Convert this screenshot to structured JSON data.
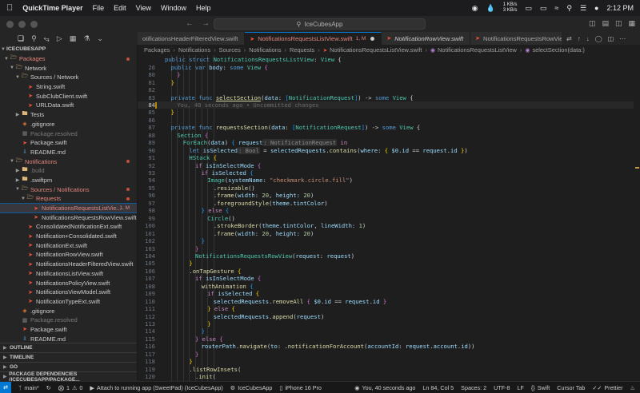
{
  "menubar": {
    "apple": "",
    "app_name": "QuickTime Player",
    "items": [
      "File",
      "Edit",
      "View",
      "Window",
      "Help"
    ],
    "net_up": "1 KB/s",
    "net_down": "3 KB/s",
    "clock": "2:12 PM"
  },
  "titlebar": {
    "search_text": "IceCubesApp"
  },
  "explorer": {
    "root": "ICECUBESAPP",
    "rows": [
      {
        "label": "Packages",
        "depth": 0,
        "type": "folder-open",
        "color": "red",
        "dot": true
      },
      {
        "label": "Network",
        "depth": 1,
        "type": "folder-open",
        "color": "white"
      },
      {
        "label": "Sources / Network",
        "depth": 2,
        "type": "folder-open",
        "color": "white"
      },
      {
        "label": "String.swift",
        "depth": 3,
        "type": "swift",
        "color": "white"
      },
      {
        "label": "SubClubClient.swift",
        "depth": 3,
        "type": "swift",
        "color": "white"
      },
      {
        "label": "URLData.swift",
        "depth": 3,
        "type": "swift",
        "color": "white"
      },
      {
        "label": "Tests",
        "depth": 2,
        "type": "folder",
        "color": "white"
      },
      {
        "label": ".gitignore",
        "depth": 2,
        "type": "git",
        "color": "white"
      },
      {
        "label": "Package.resolved",
        "depth": 2,
        "type": "file",
        "color": "gray"
      },
      {
        "label": "Package.swift",
        "depth": 2,
        "type": "swift",
        "color": "white"
      },
      {
        "label": "README.md",
        "depth": 2,
        "type": "md",
        "color": "white"
      },
      {
        "label": "Notifications",
        "depth": 1,
        "type": "folder-open",
        "color": "red",
        "dot": true
      },
      {
        "label": ".build",
        "depth": 2,
        "type": "folder",
        "color": "gray"
      },
      {
        "label": ".swiftpm",
        "depth": 2,
        "type": "folder",
        "color": "white"
      },
      {
        "label": "Sources / Notifications",
        "depth": 2,
        "type": "folder-open",
        "color": "red",
        "dot": true
      },
      {
        "label": "Requests",
        "depth": 3,
        "type": "folder-open",
        "color": "red",
        "dot": true
      },
      {
        "label": "NotificationsRequestsListVie...",
        "depth": 4,
        "type": "swift",
        "color": "red",
        "badge": "1, M",
        "selected": true
      },
      {
        "label": "NotificationsRequestsRowView.swift",
        "depth": 4,
        "type": "swift",
        "color": "white"
      },
      {
        "label": "ConsolidatedNotificationExt.swift",
        "depth": 3,
        "type": "swift",
        "color": "white"
      },
      {
        "label": "Notification+Consolidated.swift",
        "depth": 3,
        "type": "swift",
        "color": "white"
      },
      {
        "label": "NotificationExt.swift",
        "depth": 3,
        "type": "swift",
        "color": "white"
      },
      {
        "label": "NotificationRowView.swift",
        "depth": 3,
        "type": "swift",
        "color": "white"
      },
      {
        "label": "NotificationsHeaderFilteredView.swift",
        "depth": 3,
        "type": "swift",
        "color": "white"
      },
      {
        "label": "NotificationsListView.swift",
        "depth": 3,
        "type": "swift",
        "color": "white"
      },
      {
        "label": "NotificationsPolicyView.swift",
        "depth": 3,
        "type": "swift",
        "color": "white"
      },
      {
        "label": "NotificationsViewModel.swift",
        "depth": 3,
        "type": "swift",
        "color": "white"
      },
      {
        "label": "NotificationTypeExt.swift",
        "depth": 3,
        "type": "swift",
        "color": "white"
      },
      {
        "label": ".gitignore",
        "depth": 2,
        "type": "git",
        "color": "white"
      },
      {
        "label": "Package.resolved",
        "depth": 2,
        "type": "file",
        "color": "gray"
      },
      {
        "label": "Package.swift",
        "depth": 2,
        "type": "swift",
        "color": "white"
      },
      {
        "label": "README.md",
        "depth": 2,
        "type": "md",
        "color": "white"
      }
    ],
    "sections": [
      "OUTLINE",
      "TIMELINE",
      "GO",
      "PACKAGE DEPENDENCIES (ICECUBESAPP/PACKAGE..."
    ]
  },
  "tabs": [
    {
      "label": "otificationsHeaderFilteredView.swift",
      "active": false,
      "italic": false
    },
    {
      "label": "NotificationsRequestsListView.swift",
      "badge": "1, M",
      "active": true,
      "italic": false
    },
    {
      "label": "NotificationRowView.swift",
      "active": false,
      "italic": true
    },
    {
      "label": "NotificationsRequestsRowView.swift",
      "active": false,
      "italic": false
    }
  ],
  "breadcrumb": [
    "Packages",
    "Notifications",
    "Sources",
    "Notifications",
    "Requests",
    "NotificationsRequestsListView.swift",
    "NotificationsRequestsListView",
    "selectSection(data:)"
  ],
  "code": [
    {
      "n": "",
      "html": "<span class=\"kw2\">public struct</span> <span class=\"ty\">NotificationsRequestsListView</span>: <span class=\"ty\">View</span> {",
      "indent": 0
    },
    {
      "n": "26",
      "html": "<span class=\"kw2\">public var</span> <span class=\"pa\">body</span>: <span class=\"kw2\">some</span> <span class=\"ty\">View</span> <span class=\"br2\">{</span>",
      "indent": 1
    },
    {
      "n": "80",
      "html": "<span class=\"br2\">}</span>",
      "indent": 2
    },
    {
      "n": "81",
      "html": "<span class=\"br1\">}</span>",
      "indent": 1
    },
    {
      "n": "82",
      "html": "",
      "indent": 0
    },
    {
      "n": "83",
      "html": "<span class=\"kw2\">private func</span> <span class=\"fn\" style=\"text-decoration:underline\">selectSection</span>(<span class=\"pa\">data</span>: <span class=\"br3\">[</span><span class=\"ty\">NotificationRequest</span><span class=\"br3\">]</span>) -&gt; <span class=\"kw2\">some</span> <span class=\"ty\">View</span> {",
      "indent": 1
    },
    {
      "n": "84",
      "html": "<span class=\"cm\">You, 40 seconds ago • Uncommitted changes</span>",
      "indent": 2,
      "current": true,
      "mark": true
    },
    {
      "n": "85",
      "html": "<span class=\"br1\">}</span>",
      "indent": 1
    },
    {
      "n": "86",
      "html": "",
      "indent": 0
    },
    {
      "n": "87",
      "html": "<span class=\"kw2\">private func</span> <span class=\"fn\">requestsSection</span>(<span class=\"pa\">data</span>: <span class=\"br3\">[</span><span class=\"ty\">NotificationRequest</span><span class=\"br3\">]</span>) -&gt; <span class=\"kw2\">some</span> <span class=\"ty\">View</span> {",
      "indent": 1
    },
    {
      "n": "88",
      "html": "<span class=\"ty\">Section</span> <span class=\"br2\">{</span>",
      "indent": 2
    },
    {
      "n": "89",
      "html": "<span class=\"ty\">ForEach</span>(<span class=\"pa\">data</span>) <span class=\"br3\">{</span> <span class=\"pa\">request</span><span class=\"hint\">: NotificationRequest</span> <span class=\"kw\">in</span>",
      "indent": 3
    },
    {
      "n": "90",
      "html": "<span class=\"kw2\">let</span> <span class=\"pa\">isSelected</span><span class=\"hint\">: Bool</span> = <span class=\"pa\">selectedRequests</span>.<span class=\"fn\">contains</span>(<span class=\"pa\">where</span>: <span class=\"br1\">{</span> <span class=\"pa\">$0</span>.<span class=\"pa\">id</span> == <span class=\"pa\">request</span>.<span class=\"pa\">id</span> <span class=\"br1\">}</span>)",
      "indent": 4
    },
    {
      "n": "91",
      "html": "<span class=\"ty\">HStack</span> <span class=\"br1\">{</span>",
      "indent": 4
    },
    {
      "n": "92",
      "html": "<span class=\"kw\">if</span> <span class=\"pa\">isInSelectMode</span> <span class=\"br2\">{</span>",
      "indent": 5
    },
    {
      "n": "93",
      "html": "<span class=\"kw\">if</span> <span class=\"pa\">isSelected</span> <span class=\"br3\">{</span>",
      "indent": 6
    },
    {
      "n": "94",
      "html": "<span class=\"ty\">Image</span>(<span class=\"pa\">systemName</span>: <span class=\"st\">\"checkmark.circle.fill\"</span>)",
      "indent": 7
    },
    {
      "n": "95",
      "html": ".<span class=\"fn\">resizable</span>()",
      "indent": 8
    },
    {
      "n": "96",
      "html": ".<span class=\"fn\">frame</span>(<span class=\"pa\">width</span>: <span class=\"nu\">20</span>, <span class=\"pa\">height</span>: <span class=\"nu\">20</span>)",
      "indent": 8
    },
    {
      "n": "97",
      "html": ".<span class=\"fn\">foregroundStyle</span>(<span class=\"pa\">theme</span>.<span class=\"pa\">tintColor</span>)",
      "indent": 8
    },
    {
      "n": "98",
      "html": "<span class=\"br3\">}</span> <span class=\"kw\">else</span> <span class=\"br3\">{</span>",
      "indent": 6
    },
    {
      "n": "99",
      "html": "<span class=\"ty\">Circle</span>()",
      "indent": 7
    },
    {
      "n": "100",
      "html": ".<span class=\"fn\">strokeBorder</span>(<span class=\"pa\">theme</span>.<span class=\"pa\">tintColor</span>, <span class=\"pa\">lineWidth</span>: <span class=\"nu\">1</span>)",
      "indent": 8
    },
    {
      "n": "101",
      "html": ".<span class=\"fn\">frame</span>(<span class=\"pa\">width</span>: <span class=\"nu\">20</span>, <span class=\"pa\">height</span>: <span class=\"nu\">20</span>)",
      "indent": 8
    },
    {
      "n": "102",
      "html": "<span class=\"br3\">}</span>",
      "indent": 6
    },
    {
      "n": "103",
      "html": "<span class=\"br2\">}</span>",
      "indent": 5
    },
    {
      "n": "104",
      "html": "<span class=\"ty\">NotificationsRequestsRowView</span>(<span class=\"pa\">request</span>: <span class=\"pa\">request</span>)",
      "indent": 5
    },
    {
      "n": "105",
      "html": "<span class=\"br1\">}</span>",
      "indent": 4
    },
    {
      "n": "106",
      "html": ".<span class=\"fn\">onTapGesture</span> <span class=\"br1\">{</span>",
      "indent": 4
    },
    {
      "n": "107",
      "html": "<span class=\"kw\">if</span> <span class=\"pa\">isInSelectMode</span> <span class=\"br2\">{</span>",
      "indent": 5
    },
    {
      "n": "108",
      "html": "<span class=\"fn\">withAnimation</span> <span class=\"br3\">{</span>",
      "indent": 6
    },
    {
      "n": "109",
      "html": "<span class=\"kw\">if</span> <span class=\"pa\">isSelected</span> <span class=\"br1\">{</span>",
      "indent": 7
    },
    {
      "n": "110",
      "html": "<span class=\"pa\">selectedRequests</span>.<span class=\"fn\">removeAll</span> <span class=\"br2\">{</span> <span class=\"pa\">$0</span>.<span class=\"pa\">id</span> == <span class=\"pa\">request</span>.<span class=\"pa\">id</span> <span class=\"br2\">}</span>",
      "indent": 8
    },
    {
      "n": "111",
      "html": "<span class=\"br1\">}</span> <span class=\"kw\">else</span> <span class=\"br1\">{</span>",
      "indent": 7
    },
    {
      "n": "112",
      "html": "<span class=\"pa\">selectedRequests</span>.<span class=\"fn\">append</span>(<span class=\"pa\">request</span>)",
      "indent": 8
    },
    {
      "n": "113",
      "html": "<span class=\"br1\">}</span>",
      "indent": 7
    },
    {
      "n": "114",
      "html": "<span class=\"br3\">}</span>",
      "indent": 6
    },
    {
      "n": "115",
      "html": "<span class=\"br2\">}</span> <span class=\"kw\">else</span> <span class=\"br2\">{</span>",
      "indent": 5
    },
    {
      "n": "116",
      "html": "<span class=\"pa\">routerPath</span>.<span class=\"fn\">navigate</span>(<span class=\"pa\">to</span>: .<span class=\"fn\">notificationForAccount</span>(<span class=\"pa\">accountId</span>: <span class=\"pa\">request</span>.<span class=\"pa\">account</span>.<span class=\"pa\">id</span>))",
      "indent": 6
    },
    {
      "n": "117",
      "html": "<span class=\"br2\">}</span>",
      "indent": 5
    },
    {
      "n": "118",
      "html": "<span class=\"br1\">}</span>",
      "indent": 4
    },
    {
      "n": "119",
      "html": ".<span class=\"fn\">listRowInsets</span>(",
      "indent": 4
    },
    {
      "n": "120",
      "html": ".<span class=\"fn\">init</span>(",
      "indent": 5
    }
  ],
  "status": {
    "branch": "main*",
    "sync": "",
    "problems_errors": "1",
    "problems_warnings": "0",
    "attach": "Attach to running app (SweetPad) (IceCubesApp)",
    "scheme": "IceCubesApp",
    "device": "iPhone 16 Pro",
    "blame": "You, 40 seconds ago",
    "cursor": "Ln 84, Col 5",
    "spaces": "Spaces: 2",
    "encoding": "UTF-8",
    "eol": "LF",
    "language": "Swift",
    "cursor_tab": "Cursor Tab",
    "prettier": "Prettier"
  }
}
